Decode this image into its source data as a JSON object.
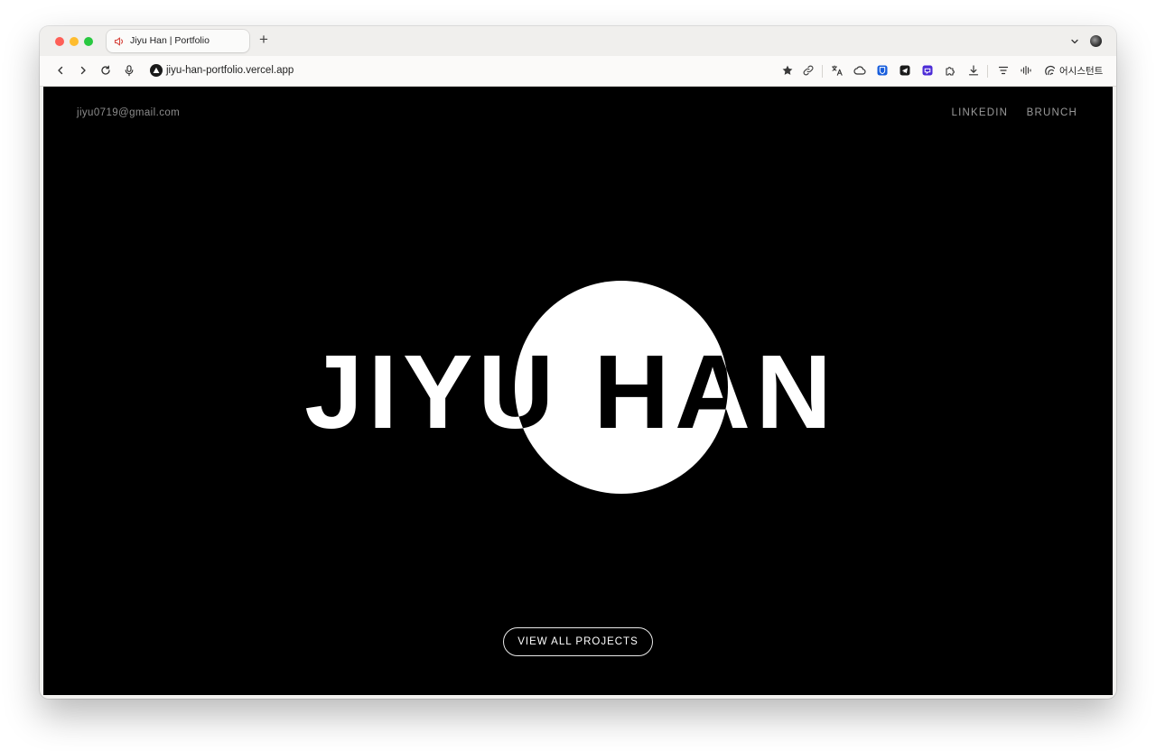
{
  "browser": {
    "tab_title": "Jiyu Han | Portfolio",
    "new_tab_symbol": "+",
    "url": "jiyu-han-portfolio.vercel.app",
    "assistant_label": "어시스턴트",
    "icons": [
      "back-icon",
      "forward-icon",
      "reload-icon",
      "microphone-icon",
      "bookmark-star-icon",
      "link-icon",
      "translate-icon",
      "cloud-icon",
      "bitwarden-icon",
      "telegram-icon",
      "extension-purple-icon",
      "puzzle-icon",
      "download-icon",
      "reader-icon",
      "audio-wave-icon",
      "assistant-icon"
    ]
  },
  "page": {
    "email": "jiyu0719@gmail.com",
    "nav": {
      "linkedin": "LINKEDIN",
      "brunch": "BRUNCH"
    },
    "hero_title": "JIYU HAN",
    "cta_label": "VIEW ALL PROJECTS"
  },
  "colors": {
    "page_bg": "#000000",
    "accent": "#ffffff"
  }
}
